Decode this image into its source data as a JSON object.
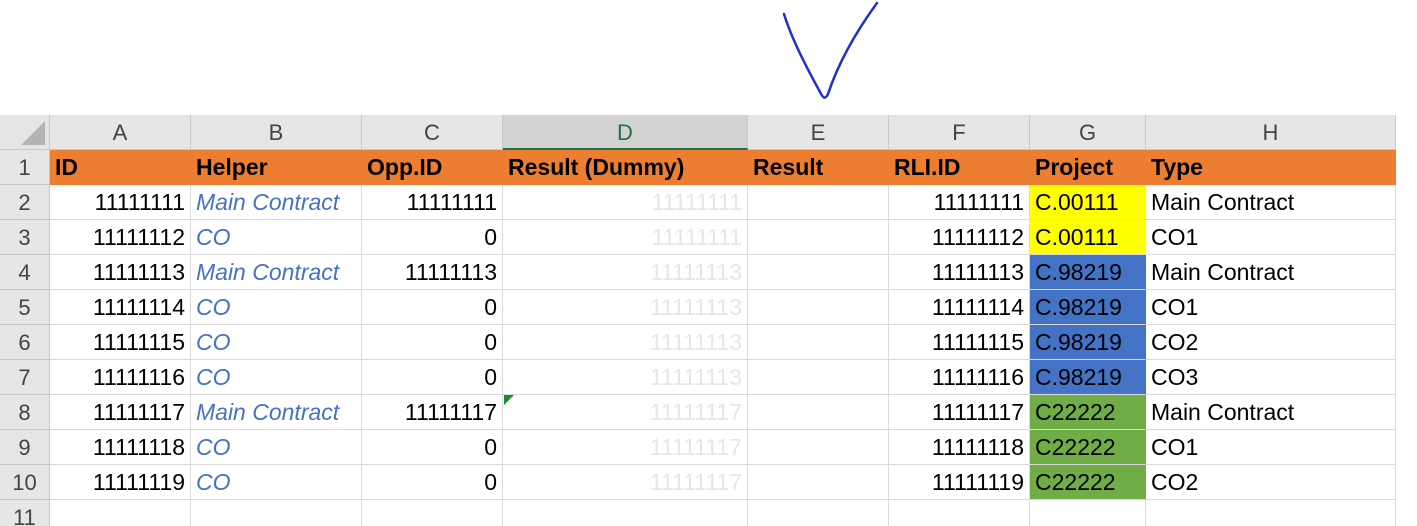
{
  "columns": [
    "A",
    "B",
    "C",
    "D",
    "E",
    "F",
    "G",
    "H"
  ],
  "selected_column": "D",
  "header_row": {
    "row_number": "1",
    "cells": [
      "ID",
      "Helper",
      "Opp.ID",
      "Result (Dummy)",
      "Result",
      "RLI.ID",
      "Project",
      "Type"
    ]
  },
  "rows": [
    {
      "row_number": "2",
      "id": "11111111",
      "helper": "Main Contract",
      "opp_id": "11111111",
      "result_dummy": "11111111",
      "result": "",
      "rli_id": "11111111",
      "project": "C.00111",
      "type": "Main Contract"
    },
    {
      "row_number": "3",
      "id": "11111112",
      "helper": "CO",
      "opp_id": "0",
      "result_dummy": "11111111",
      "result": "",
      "rli_id": "11111112",
      "project": "C.00111",
      "type": "CO1"
    },
    {
      "row_number": "4",
      "id": "11111113",
      "helper": "Main Contract",
      "opp_id": "11111113",
      "result_dummy": "11111113",
      "result": "",
      "rli_id": "11111113",
      "project": "C.98219",
      "type": "Main Contract"
    },
    {
      "row_number": "5",
      "id": "11111114",
      "helper": "CO",
      "opp_id": "0",
      "result_dummy": "11111113",
      "result": "",
      "rli_id": "11111114",
      "project": "C.98219",
      "type": "CO1"
    },
    {
      "row_number": "6",
      "id": "11111115",
      "helper": "CO",
      "opp_id": "0",
      "result_dummy": "11111113",
      "result": "",
      "rli_id": "11111115",
      "project": "C.98219",
      "type": "CO2"
    },
    {
      "row_number": "7",
      "id": "11111116",
      "helper": "CO",
      "opp_id": "0",
      "result_dummy": "11111113",
      "result": "",
      "rli_id": "11111116",
      "project": "C.98219",
      "type": "CO3"
    },
    {
      "row_number": "8",
      "id": "11111117",
      "helper": "Main Contract",
      "opp_id": "11111117",
      "result_dummy": "11111117",
      "result": "",
      "rli_id": "11111117",
      "project": "C22222",
      "type": "Main Contract"
    },
    {
      "row_number": "9",
      "id": "11111118",
      "helper": "CO",
      "opp_id": "0",
      "result_dummy": "11111117",
      "result": "",
      "rli_id": "11111118",
      "project": "C22222",
      "type": "CO1"
    },
    {
      "row_number": "10",
      "id": "11111119",
      "helper": "CO",
      "opp_id": "0",
      "result_dummy": "11111117",
      "result": "",
      "rli_id": "11111119",
      "project": "C22222",
      "type": "CO2"
    }
  ],
  "empty_row": {
    "row_number": "11"
  },
  "colors": {
    "header_fill": "#ed7d31",
    "project_yellow": "#ffff00",
    "project_blue": "#4472c4",
    "project_green": "#70ad47",
    "helper_text": "#4472c4",
    "dummy_text": "#e6e6e6",
    "annotation_ink": "#1f2fd0"
  },
  "annotation": {
    "icon": "hand-drawn-down-arrow-icon"
  }
}
